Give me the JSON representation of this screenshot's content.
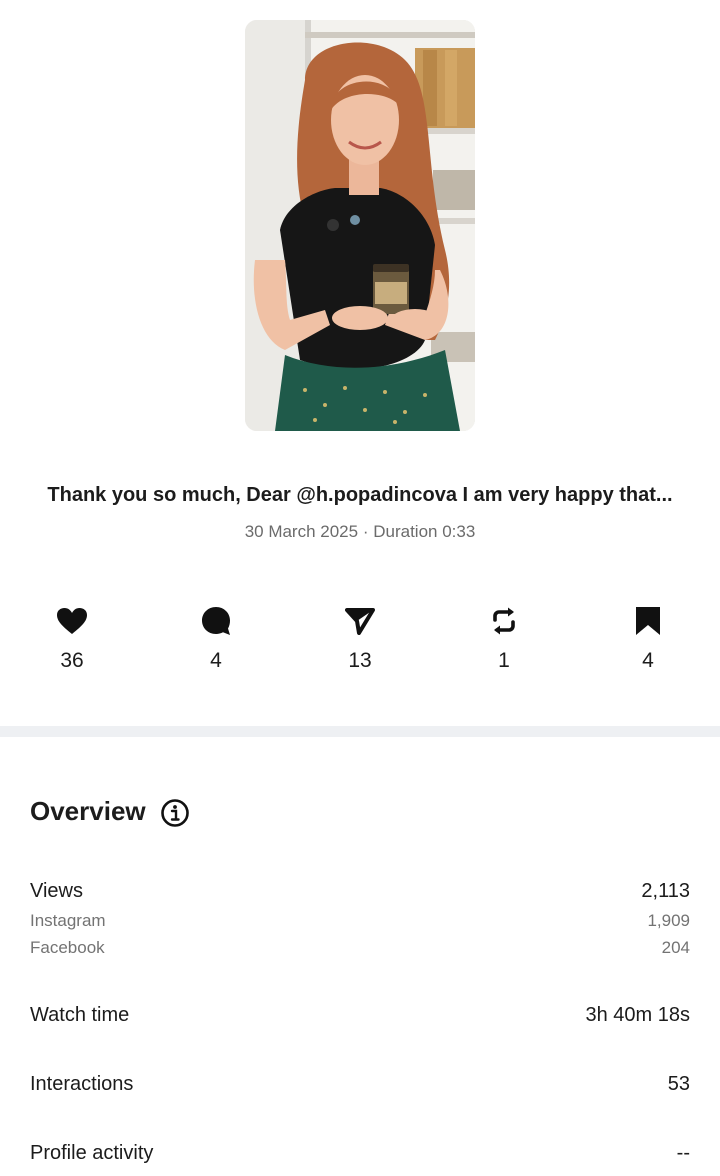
{
  "post": {
    "caption": "Thank you so much, Dear @h.popadincova  I am very happy that...",
    "date": "30 March 2025",
    "separator": "·",
    "duration_label": "Duration 0:33"
  },
  "stats": [
    {
      "icon": "heart-icon",
      "value": "36"
    },
    {
      "icon": "comment-icon",
      "value": "4"
    },
    {
      "icon": "share-icon",
      "value": "13"
    },
    {
      "icon": "repost-icon",
      "value": "1"
    },
    {
      "icon": "bookmark-icon",
      "value": "4"
    }
  ],
  "overview": {
    "title": "Overview",
    "views_label": "Views",
    "views_value": "2,113",
    "instagram_label": "Instagram",
    "instagram_value": "1,909",
    "facebook_label": "Facebook",
    "facebook_value": "204",
    "watch_time_label": "Watch time",
    "watch_time_value": "3h 40m 18s",
    "interactions_label": "Interactions",
    "interactions_value": "53",
    "profile_activity_label": "Profile activity",
    "profile_activity_value": "--"
  }
}
